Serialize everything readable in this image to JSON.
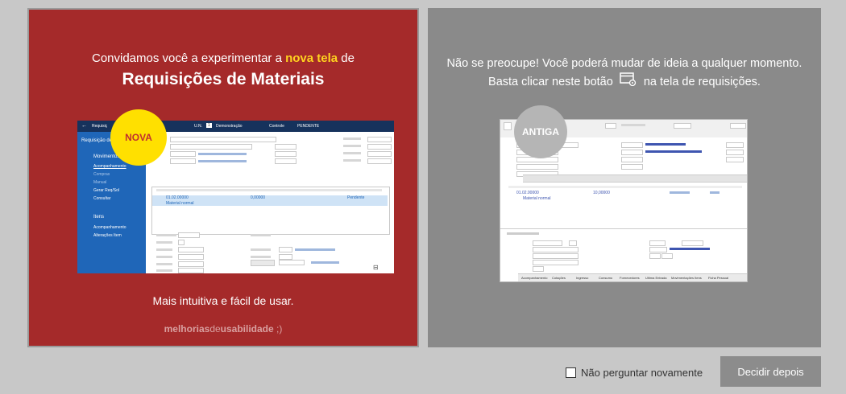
{
  "new_panel": {
    "line1_before": "Convidamos você a experimentar a ",
    "line1_highlight": "nova tela",
    "line1_after": " de",
    "title": "Requisições de Materiais",
    "badge": "NOVA",
    "caption": "Mais intuitiva e fácil de usar.",
    "brand_a": "melhorias",
    "brand_b": "de",
    "brand_c": "usabilidade",
    "brand_d": " ;)",
    "mini": {
      "header_title": "Requisiç",
      "un_label": "U.N.",
      "un_value": "1",
      "un_name": "Demonstração",
      "controle_label": "Controle",
      "controle_value": "PENDENTE",
      "sidebar_title": "Requisição de",
      "sidebar_section1": "Movimentos",
      "sidebar_items1": [
        "Acompanhamento",
        "Compras",
        "Manual",
        "Gerar Req/Sol",
        "Consultar"
      ],
      "sidebar_section2": "Itens",
      "sidebar_items2": [
        "Acompanhamento",
        "Alterações Item"
      ],
      "item_code": "01.02.00000",
      "item_qty": "0,00000",
      "item_status": "Pendente",
      "item_desc": "Material normal"
    }
  },
  "old_panel": {
    "text_before": "Não se preocupe! Você poderá mudar de ideia a qualquer momento. Basta clicar neste botão",
    "text_after": "na tela de requisições.",
    "badge": "ANTIGA",
    "mini": {
      "item_code": "01.02.00000",
      "item_qty": "10,00000",
      "item_desc": "Material normal",
      "tabs": [
        "Acompanhamento",
        "Cotações",
        "Ingresso",
        "Consumo",
        "Fornecedores",
        "Ultima Entrada",
        "Movimentações Itens",
        "Ficha Pessoal"
      ]
    }
  },
  "footer": {
    "checkbox_label": "Não perguntar novamente",
    "checkbox_checked": false,
    "button_label": "Decidir depois"
  },
  "colors": {
    "new_bg": "#a52a2a",
    "old_bg": "#8a8a8a",
    "highlight": "#ffd21f",
    "badge_new": "#ffe000",
    "mini_blue": "#1f66b8"
  }
}
